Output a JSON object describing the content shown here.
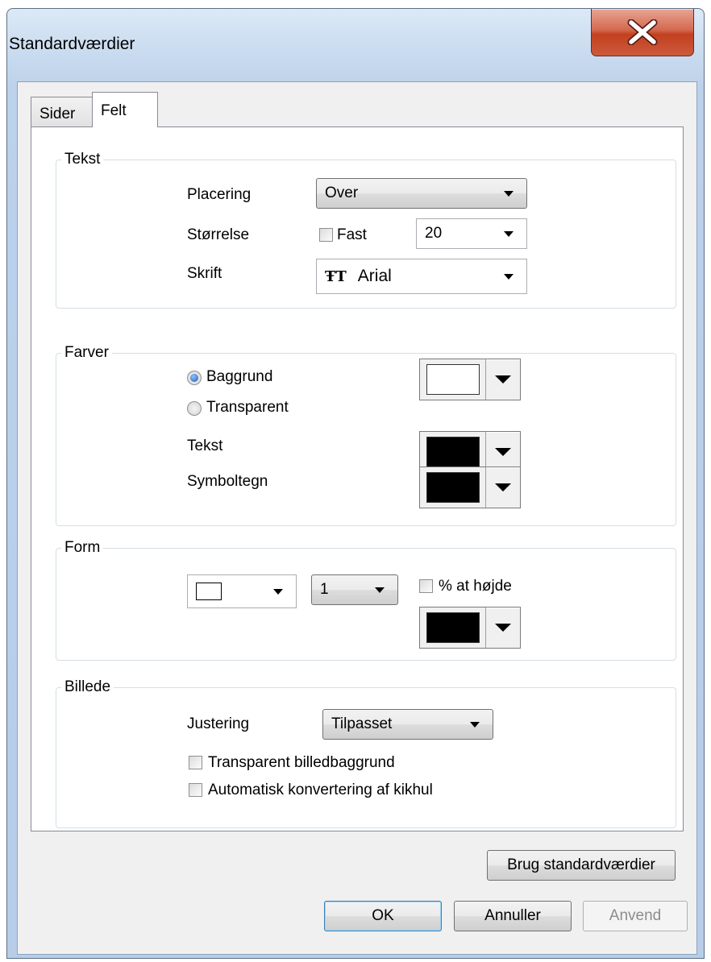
{
  "window": {
    "title": "Standardværdier"
  },
  "tabs": [
    {
      "label": "Sider",
      "active": false
    },
    {
      "label": "Felt",
      "active": true
    }
  ],
  "tekst": {
    "title": "Tekst",
    "placering_label": "Placering",
    "placering_value": "Over",
    "storrelse_label": "Størrelse",
    "fast_label": "Fast",
    "fast_checked": false,
    "size_value": "20",
    "skrift_label": "Skrift",
    "skrift_value": "Arial",
    "skrift_icon": "truetype-font-icon"
  },
  "farver": {
    "title": "Farver",
    "baggrund_label": "Baggrund",
    "transparent_label": "Transparent",
    "selected_option": "Baggrund",
    "baggrund_color": "#ffffff",
    "tekst_label": "Tekst",
    "tekst_color": "#000000",
    "symboltegn_label": "Symboltegn",
    "symboltegn_color": "#000000"
  },
  "form": {
    "title": "Form",
    "shape_icon": "rectangle-outline-icon",
    "line_width_value": "1",
    "percent_label": "% at højde",
    "percent_checked": false,
    "form_color": "#000000"
  },
  "billede": {
    "title": "Billede",
    "justering_label": "Justering",
    "justering_value": "Tilpasset",
    "transparent_bg_label": "Transparent billedbaggrund",
    "transparent_bg_checked": false,
    "auto_convert_label": "Automatisk konvertering af kikhul",
    "auto_convert_checked": false
  },
  "buttons": {
    "use_defaults": "Brug standardværdier",
    "ok": "OK",
    "cancel": "Annuller",
    "apply": "Anvend"
  }
}
